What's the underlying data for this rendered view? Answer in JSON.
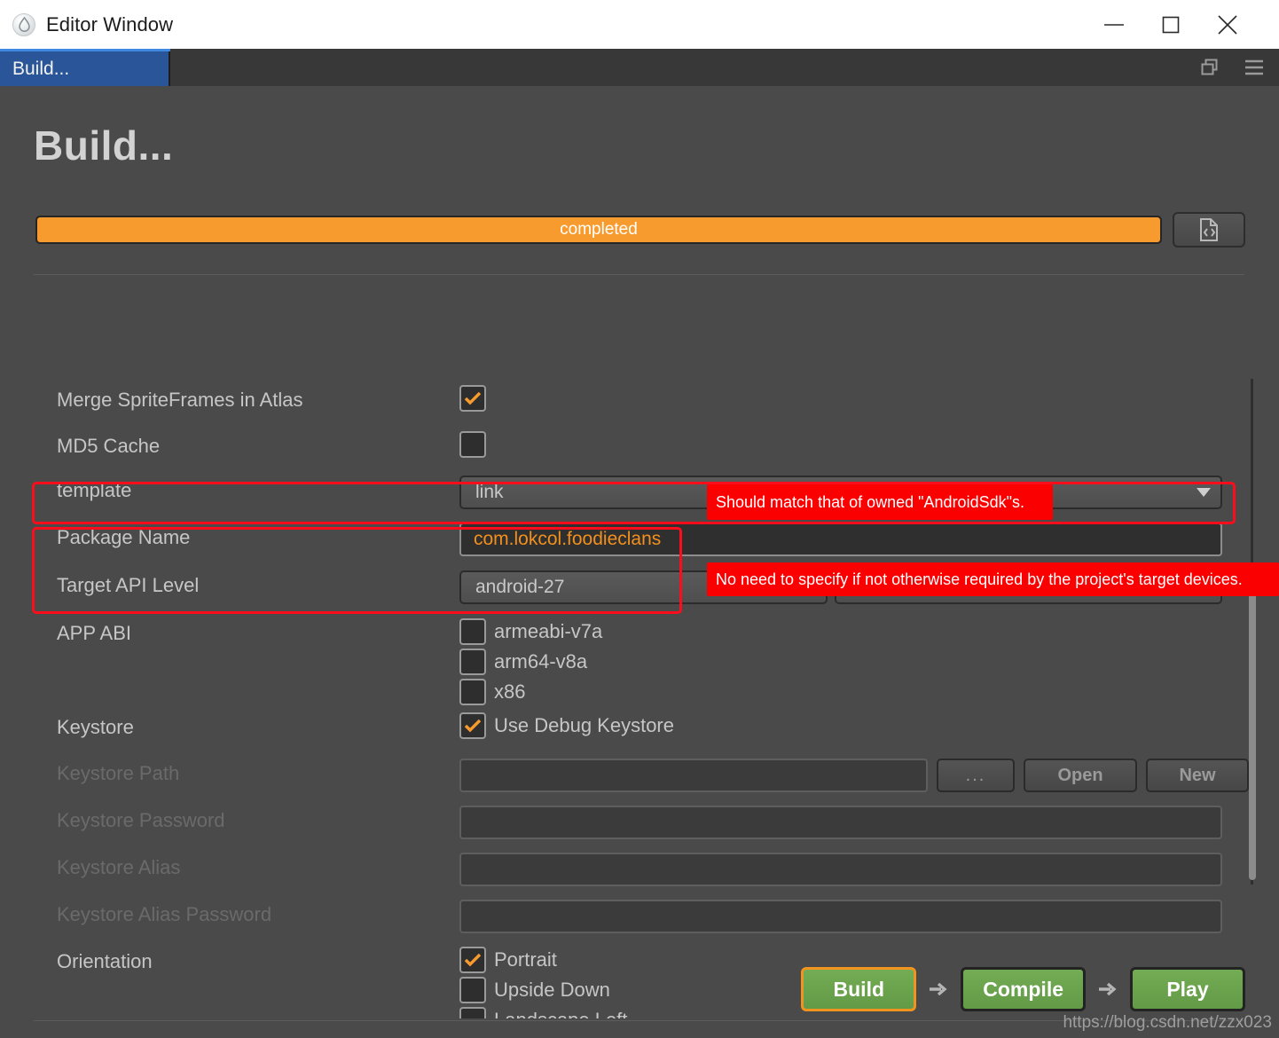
{
  "window": {
    "title": "Editor Window",
    "logo_icon": "droplet-logo-icon",
    "minimize_icon": "minimize-icon",
    "maximize_icon": "maximize-icon",
    "close_icon": "close-icon"
  },
  "tabstrip": {
    "tabs": [
      {
        "label": "Build..."
      }
    ],
    "restore_icon": "restore-window-icon",
    "menu_icon": "hamburger-menu-icon"
  },
  "page": {
    "title": "Build..."
  },
  "progress": {
    "status_label": "completed",
    "percent": 100,
    "code_icon": "code-file-icon"
  },
  "form": {
    "merge_spriteframes": {
      "label": "Merge SpriteFrames in Atlas",
      "checked": true
    },
    "md5_cache": {
      "label": "MD5 Cache",
      "checked": false
    },
    "template": {
      "label": "template",
      "value": "link"
    },
    "package_name": {
      "label": "Package Name",
      "value": "com.lokcol.foodieclans"
    },
    "target_api_level": {
      "label": "Target API Level",
      "value": "android-27",
      "extra_value": ""
    },
    "app_abi": {
      "label": "APP ABI",
      "options": [
        {
          "label": "armeabi-v7a",
          "checked": false
        },
        {
          "label": "arm64-v8a",
          "checked": false
        },
        {
          "label": "x86",
          "checked": false
        }
      ]
    },
    "keystore": {
      "label": "Keystore",
      "option_label": "Use Debug Keystore",
      "checked": true
    },
    "keystore_path": {
      "label": "Keystore Path",
      "value": "",
      "dots_label": "...",
      "open_label": "Open",
      "new_label": "New"
    },
    "keystore_password": {
      "label": "Keystore Password",
      "value": ""
    },
    "keystore_alias": {
      "label": "Keystore Alias",
      "value": ""
    },
    "keystore_alias_password": {
      "label": "Keystore Alias Password",
      "value": ""
    },
    "orientation": {
      "label": "Orientation",
      "options": [
        {
          "label": "Portrait",
          "checked": true
        },
        {
          "label": "Upside Down",
          "checked": false
        },
        {
          "label": "Landscape Left",
          "checked": false
        }
      ]
    }
  },
  "annotations": [
    {
      "text": "Should match that of owned \"AndroidSdk\"s."
    },
    {
      "text": "No need to specify if not otherwise required by the project's target devices."
    }
  ],
  "footer": {
    "build_label": "Build",
    "compile_label": "Compile",
    "play_label": "Play",
    "arrow_icon": "arrow-right-icon",
    "watermark": "https://blog.csdn.net/zzx023"
  },
  "colors": {
    "accent_orange": "#f89b2e",
    "annotation_red": "#fb0000",
    "tab_blue": "#2a5699",
    "action_green": "#679e4a"
  }
}
